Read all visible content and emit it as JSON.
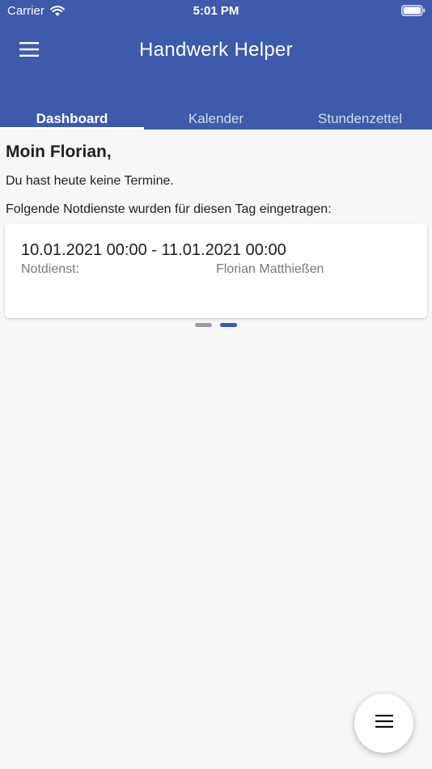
{
  "status_bar": {
    "carrier": "Carrier",
    "time": "5:01 PM"
  },
  "appbar": {
    "title": "Handwerk Helper",
    "menu_icon": "hamburger-menu-icon"
  },
  "tabs": [
    {
      "label": "Dashboard",
      "active": true
    },
    {
      "label": "Kalender",
      "active": false
    },
    {
      "label": "Stundenzettel",
      "active": false
    }
  ],
  "dashboard": {
    "greeting": "Moin Florian,",
    "no_appointments": "Du hast heute keine Termine.",
    "emergency_intro": "Folgende Notdienste wurden für diesen Tag eingetragen:",
    "card": {
      "range": "10.01.2021 00:00 - 11.01.2021 00:00",
      "label": "Notdienst:",
      "value": "Florian Matthießen"
    },
    "pager": {
      "total": 2,
      "active_index": 1
    }
  },
  "fab": {
    "icon": "hamburger-menu-icon"
  },
  "colors": {
    "primary": "#3d5aab",
    "background": "#f7f7f7",
    "card": "#ffffff",
    "muted_text": "#7a7a7a"
  }
}
